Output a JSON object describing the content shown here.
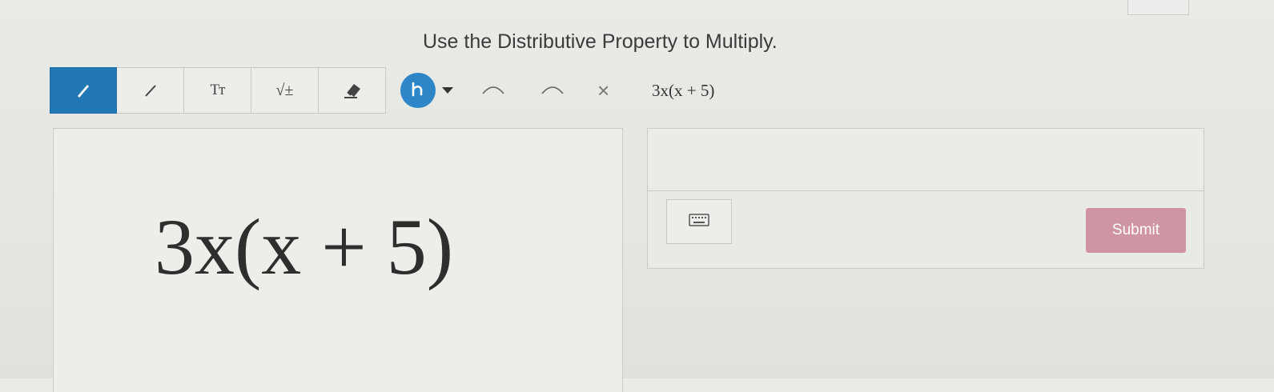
{
  "instruction": "Use the Distributive Property to Multiply.",
  "toolbar": {
    "tools": [
      {
        "icon": "pencil-icon",
        "active": true
      },
      {
        "icon": "line-icon"
      },
      {
        "icon": "text-size-icon",
        "label": "Tт"
      },
      {
        "icon": "sqrt-plus-minus-icon",
        "label": "√±"
      },
      {
        "icon": "eraser-icon"
      }
    ],
    "scribble_icon": "scribble-icon",
    "undo_icon": "undo-icon",
    "redo_icon": "redo-icon",
    "clear_label": "×",
    "expression": "3x(x + 5)"
  },
  "canvas": {
    "expression": "3x(x + 5)"
  },
  "answer": {
    "input_value": "",
    "keyboard_icon": "keyboard-icon",
    "submit_label": "Submit"
  },
  "colors": {
    "active_tool": "#2277b5",
    "scribble_button": "#2d86c8",
    "submit_button": "#cf95a2"
  }
}
